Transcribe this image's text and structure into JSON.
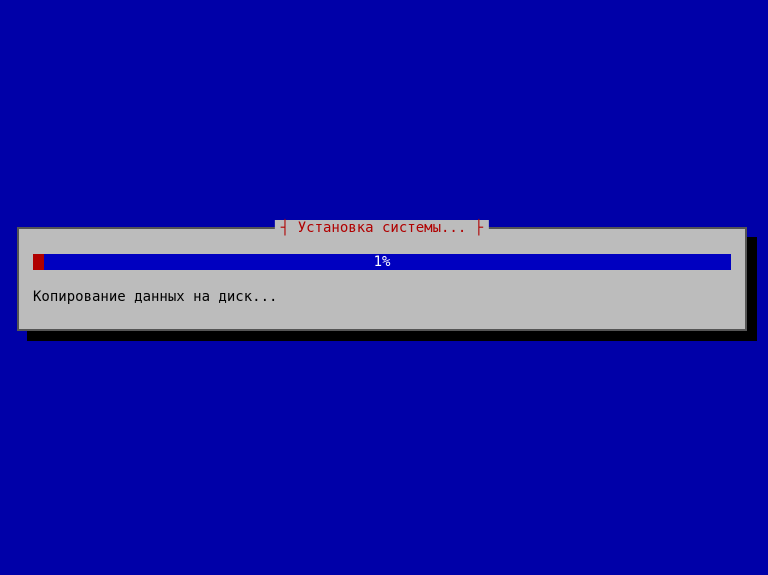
{
  "dialog": {
    "title": "Установка системы...",
    "progress": {
      "percent": 1,
      "label": "1%",
      "fill_width": "1.6%"
    },
    "status": "Копирование данных на диск..."
  },
  "colors": {
    "background": "#0000A8",
    "panel": "#BCBCBC",
    "border": "#555555",
    "shadow": "#000000",
    "title_text": "#B00000",
    "progress_bg": "#0000C0",
    "progress_fill": "#B00000",
    "progress_text": "#FFFFFF",
    "status_text": "#000000"
  }
}
